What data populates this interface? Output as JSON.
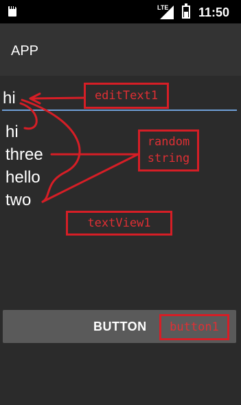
{
  "status_bar": {
    "network_label": "LTE",
    "time": "11:50",
    "icons": [
      "sd-card-icon",
      "signal-icon",
      "battery-icon"
    ]
  },
  "action_bar": {
    "title": "APP"
  },
  "edit_text": {
    "value": "hi"
  },
  "text_view": {
    "items": [
      "hi",
      "three",
      "hello",
      "two"
    ]
  },
  "button": {
    "label": "BUTTON"
  },
  "annotations": {
    "edit_text": "editText1",
    "random_string": "random\nstring",
    "text_view": "textView1",
    "button": "button1"
  },
  "colors": {
    "background": "#2b2b2b",
    "action_bar": "#333333",
    "underline": "#6f9fd8",
    "button": "#5a5a5a",
    "annotation": "#d61e26"
  }
}
